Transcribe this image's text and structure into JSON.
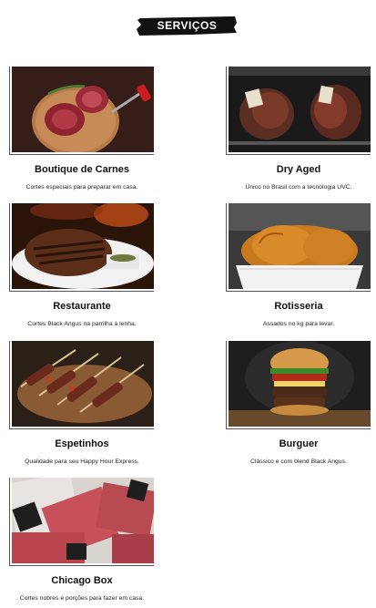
{
  "header": {
    "title": "SERVIÇOS"
  },
  "services": [
    {
      "title": "Boutique de Carnes",
      "description": "Cortes especiais para preparar em casa."
    },
    {
      "title": "Dry Aged",
      "description": "Único no Brasil com a tecnologia UVC."
    },
    {
      "title": "Restaurante",
      "description": "Cortes Black Angus na parrilha à lenha."
    },
    {
      "title": "Rotisseria",
      "description": "Assados no kg para levar."
    },
    {
      "title": "Espetinhos",
      "description": "Qualidade para seu Happy Hour Express."
    },
    {
      "title": "Burguer",
      "description": "Clássico e com blend Black Angus."
    },
    {
      "title": "Chicago Box",
      "description": "Cortes nobres e porções para fazer em casa."
    }
  ],
  "colors": {
    "banner": "#111111",
    "text": "#111111",
    "background": "#ffffff"
  }
}
